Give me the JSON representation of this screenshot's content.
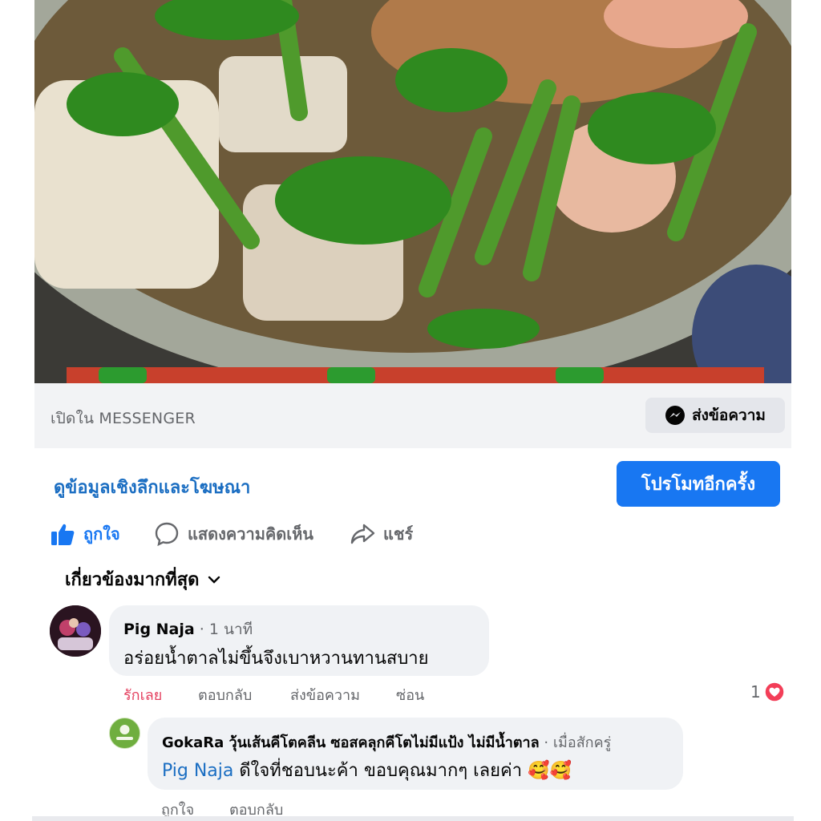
{
  "post_image": {
    "description_icon": "food-photo"
  },
  "messenger_bar": {
    "open_label": "เปิดใน MESSENGER",
    "send_button_label": "ส่งข้อความ",
    "send_icon": "messenger-icon"
  },
  "insights_link": "ดูข้อมูลเชิงลึกและโฆษณา",
  "promote_button": "โปรโมทอีกครั้ง",
  "actions": {
    "like": "ถูกใจ",
    "comment": "แสดงความคิดเห็น",
    "share": "แชร์"
  },
  "sort_label": "เกี่ยวข้องมากที่สุด",
  "comments": [
    {
      "author": "Pig Naja",
      "time": " · 1 นาที",
      "text": "อร่อยน้ำตาลไม่ขึ้นจึงเบาหวานทานสบาย",
      "actions": [
        "รักเลย",
        "ตอบกลับ",
        "ส่งข้อความ",
        "ซ่อน"
      ],
      "reaction_count": "1"
    },
    {
      "author": "GokaRa วุ้นเส้นคีโตคลีน ซอสคลุกคีโตไม่มีแป้ง ไม่มีน้ำตาล",
      "time": " · เมื่อสักครู่",
      "mention": "Pig Naja",
      "text": " ดีใจที่ชอบนะค้า ขอบคุณมากๆ เลยค่า 🥰🥰",
      "actions": [
        "ถูกใจ",
        "ตอบกลับ"
      ]
    }
  ],
  "colors": {
    "accent": "#1877f2",
    "love": "#e4405f",
    "muted": "#65676b"
  }
}
